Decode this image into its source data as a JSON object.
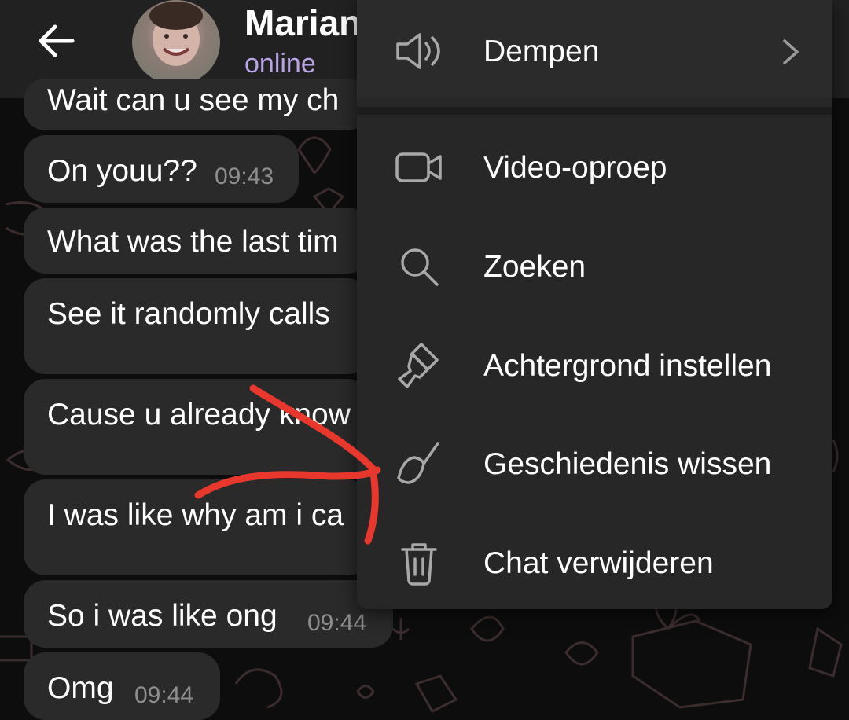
{
  "header": {
    "contact_name": "Marian",
    "status": "online"
  },
  "messages": [
    {
      "text": "Wait can u see my ch",
      "time": ""
    },
    {
      "text": "On youu??",
      "time": "09:43"
    },
    {
      "text": "What was the last tim",
      "time": ""
    },
    {
      "text": "See it randomly calls",
      "time": ""
    },
    {
      "text": "Cause u already know",
      "time": ""
    },
    {
      "text": "I was like why am i ca",
      "time": ""
    },
    {
      "text": "So i was like ong",
      "time": "09:44"
    },
    {
      "text": "Omg",
      "time": "09:44"
    }
  ],
  "menu": {
    "items": [
      {
        "label": "Dempen",
        "icon": "speaker-icon"
      },
      {
        "label": "Video-oproep",
        "icon": "video-camera-icon"
      },
      {
        "label": "Zoeken",
        "icon": "search-icon"
      },
      {
        "label": "Achtergrond instellen",
        "icon": "paint-brush-icon"
      },
      {
        "label": "Geschiedenis wissen",
        "icon": "broom-icon"
      },
      {
        "label": "Chat verwijderen",
        "icon": "trash-icon"
      }
    ]
  },
  "colors": {
    "header_bg": "#212121",
    "menu_bg": "#272727",
    "bubble_bg": "#2a2a2a",
    "status_accent": "#b9a4e6",
    "annotation_red": "#e8372c"
  }
}
